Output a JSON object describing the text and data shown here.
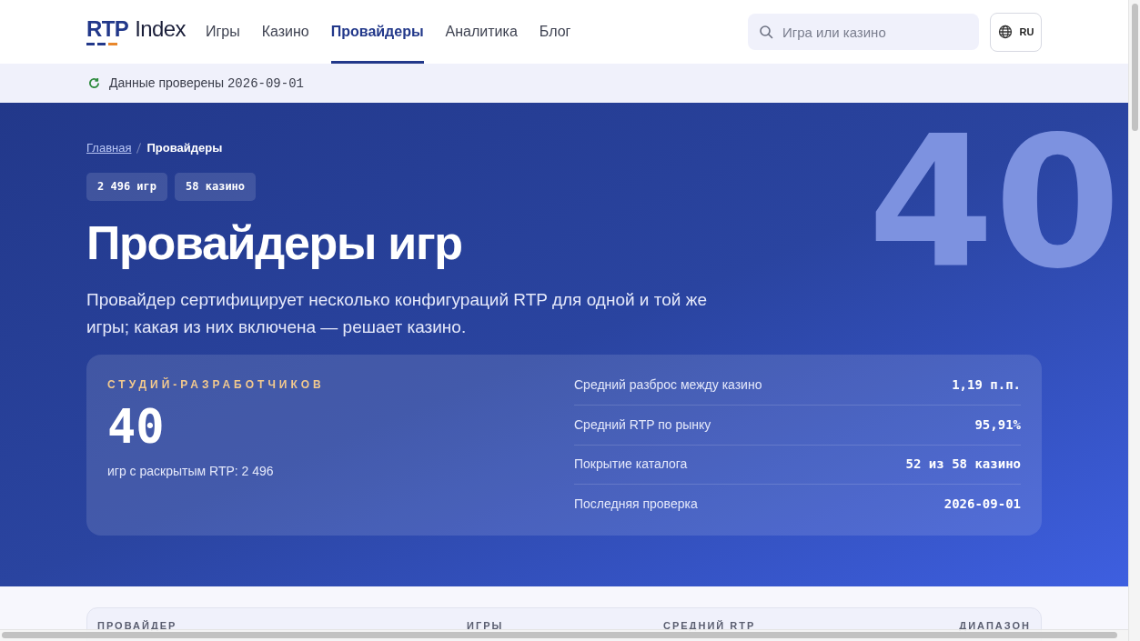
{
  "logo": {
    "primary": "RTP",
    "secondary": "Index"
  },
  "nav": [
    {
      "label": "Игры",
      "selected": false
    },
    {
      "label": "Казино",
      "selected": false
    },
    {
      "label": "Провайдеры",
      "selected": true
    },
    {
      "label": "Аналитика",
      "selected": false
    },
    {
      "label": "Блог",
      "selected": false
    }
  ],
  "search": {
    "placeholder": "Игра или казино"
  },
  "language_button": "RU",
  "status_bar": {
    "text": "Данные проверены",
    "date": "2026-09-01"
  },
  "hero": {
    "watermark": "40",
    "breadcrumbs": [
      {
        "label": "Главная",
        "selected": false
      },
      {
        "label": "Провайдеры",
        "selected": true
      }
    ],
    "badges": [
      "2 496 игр",
      "58 казино"
    ],
    "title": "Провайдеры игр",
    "subtitle": "Провайдер сертифицирует несколько конфигураций RTP для одной и той же игры; какая из них включена — решает казино.",
    "summary": {
      "label": "СТУДИЙ-РАЗРАБОТЧИКОВ",
      "value": "40",
      "note": "игр с раскрытым RTP: 2 496",
      "stats": [
        {
          "label": "Средний разброс между казино",
          "value": "1,19 п.п."
        },
        {
          "label": "Средний RTP по рынку",
          "value": "95,91%"
        },
        {
          "label": "Покрытие каталога",
          "value": "52 из 58 казино"
        },
        {
          "label": "Последняя проверка",
          "value": "2026-09-01"
        }
      ]
    }
  },
  "table": {
    "columns": [
      "ПРОВАЙДЕР",
      "ИГРЫ",
      "СРЕДНИЙ RTP",
      "ДИАПАЗОН"
    ]
  }
}
